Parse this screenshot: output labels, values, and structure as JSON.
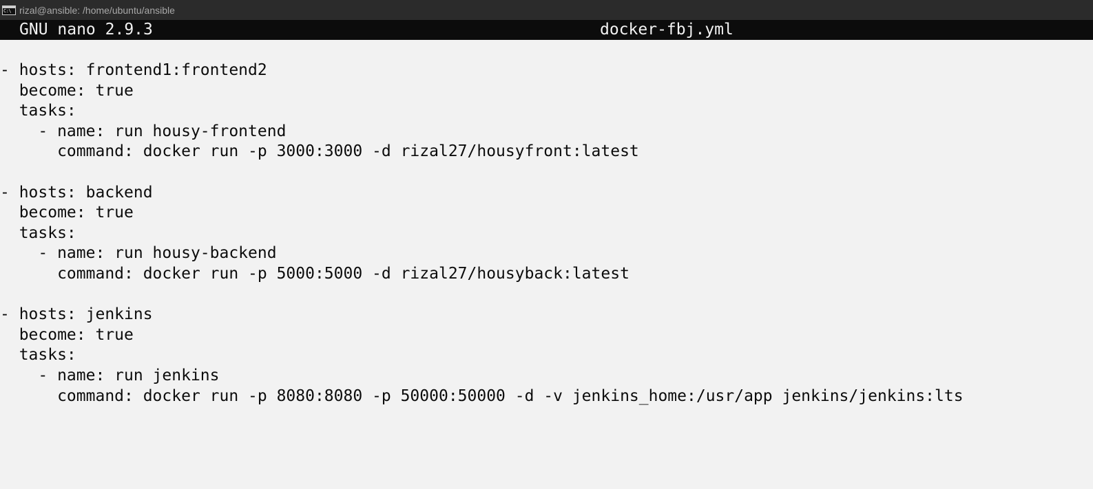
{
  "window": {
    "title": "rizal@ansible: /home/ubuntu/ansible",
    "icon": "cmd-icon"
  },
  "nano": {
    "version": "GNU nano 2.9.3",
    "filename": "docker-fbj.yml"
  },
  "editor": {
    "lines": [
      "- hosts: frontend1:frontend2",
      "  become: true",
      "  tasks:",
      "    - name: run housy-frontend",
      "      command: docker run -p 3000:3000 -d rizal27/housyfront:latest",
      "",
      "- hosts: backend",
      "  become: true",
      "  tasks:",
      "    - name: run housy-backend",
      "      command: docker run -p 5000:5000 -d rizal27/housyback:latest",
      "",
      "- hosts: jenkins",
      "  become: true",
      "  tasks:",
      "    - name: run jenkins",
      "      command: docker run -p 8080:8080 -p 50000:50000 -d -v jenkins_home:/usr/app jenkins/jenkins:lts"
    ]
  }
}
